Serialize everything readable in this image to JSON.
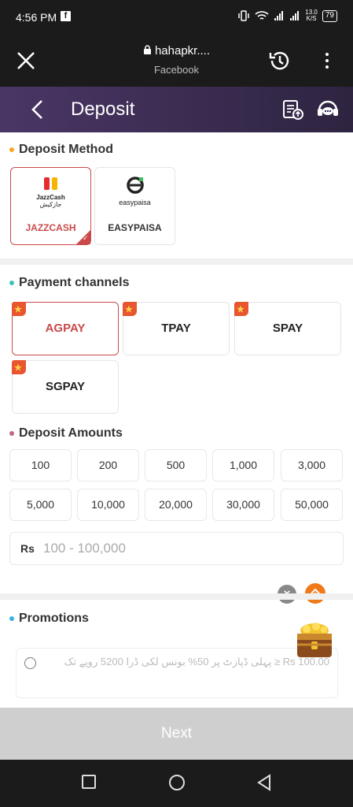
{
  "status_bar": {
    "time": "4:56 PM",
    "net_speed": "13.0",
    "net_unit": "K/S",
    "battery": "79"
  },
  "browser": {
    "url": "hahapkr....",
    "source": "Facebook"
  },
  "header": {
    "title": "Deposit"
  },
  "deposit_method": {
    "title": "Deposit Method",
    "methods": [
      {
        "label": "JAZZCASH",
        "logo_text": "JazzCash",
        "logo_sub": "جازکیش",
        "selected": true
      },
      {
        "label": "EASYPAISA",
        "logo_text": "easypaisa",
        "selected": false
      }
    ]
  },
  "payment_channels": {
    "title": "Payment channels",
    "items": [
      {
        "label": "AGPAY",
        "selected": true
      },
      {
        "label": "TPAY",
        "selected": false
      },
      {
        "label": "SPAY",
        "selected": false
      },
      {
        "label": "SGPAY",
        "selected": false
      }
    ]
  },
  "deposit_amounts": {
    "title": "Deposit Amounts",
    "values": [
      "100",
      "200",
      "500",
      "1,000",
      "3,000",
      "5,000",
      "10,000",
      "20,000",
      "30,000",
      "50,000"
    ],
    "currency": "Rs",
    "placeholder": "100 - 100,000"
  },
  "promotions": {
    "title": "Promotions",
    "offer_text": "پہلی ڈپازٹ پر 50% بونس لکی ڈرا 5200 روپے تک ≥ Rs 100.00"
  },
  "next_label": "Next",
  "colors": {
    "accent": "#c94a4a",
    "header_start": "#4a3666",
    "header_end": "#2e2440",
    "next_disabled": "#cfcfcf"
  }
}
